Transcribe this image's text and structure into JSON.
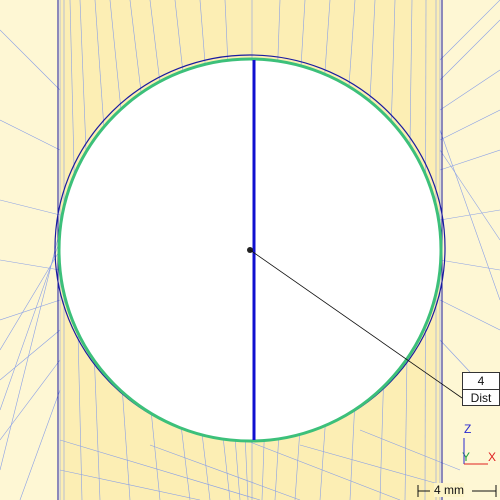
{
  "viewport": {
    "background_color": "#fdf4c8",
    "mesh_color": "#8aa0e6",
    "outer_circle_color": "#1a1aa0",
    "inner_circle_color": "#3cc07a",
    "radius_line_color": "#1010d0"
  },
  "dimension": {
    "value": "4",
    "label": "Dist"
  },
  "triad": {
    "z": "Z",
    "y": "Y",
    "x": "X",
    "z_color": "#2a2ad0",
    "y_color": "#20a040",
    "x_color": "#e02020"
  },
  "scale": {
    "label": "4 mm"
  }
}
